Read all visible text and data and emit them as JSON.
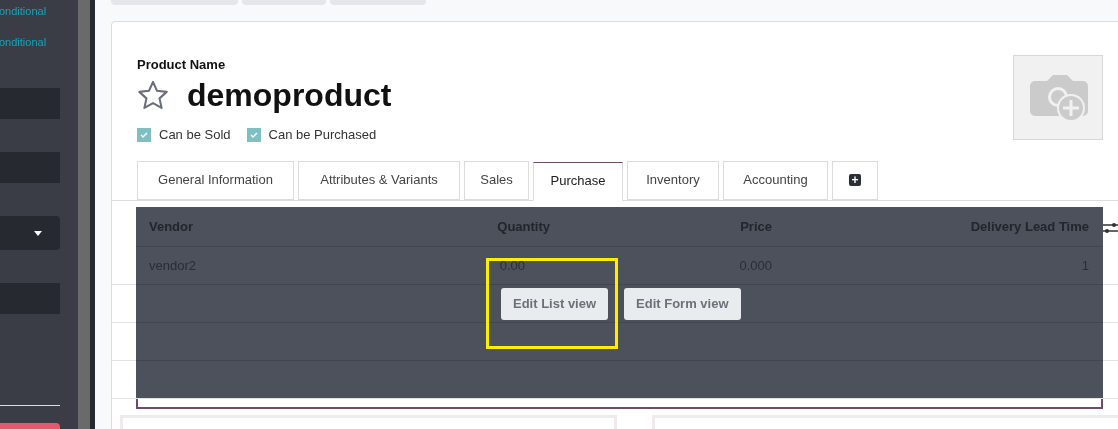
{
  "sidebar": {
    "links": [
      "onditional",
      "onditional"
    ],
    "fields": [
      {
        "kind": "input"
      },
      {
        "kind": "input"
      },
      {
        "kind": "select"
      },
      {
        "kind": "input"
      }
    ]
  },
  "product": {
    "label": "Product Name",
    "name": "demoproduct",
    "favorite": false,
    "options": [
      {
        "label": "Can be Sold",
        "checked": true
      },
      {
        "label": "Can be Purchased",
        "checked": true
      }
    ]
  },
  "tabs": [
    {
      "label": "General Information",
      "selected": false
    },
    {
      "label": "Attributes & Variants",
      "selected": false
    },
    {
      "label": "Sales",
      "selected": false
    },
    {
      "label": "Purchase",
      "selected": true
    },
    {
      "label": "Inventory",
      "selected": false
    },
    {
      "label": "Accounting",
      "selected": false
    },
    {
      "label": "+",
      "kind": "add",
      "selected": false
    }
  ],
  "table": {
    "columns": [
      {
        "label": "Vendor"
      },
      {
        "label": "Quantity"
      },
      {
        "label": "Price"
      },
      {
        "label": "Delivery Lead Time"
      }
    ],
    "rows": [
      [
        "vendor2",
        "0.00",
        "0.000",
        "1"
      ]
    ]
  },
  "overlay_buttons": [
    "Edit List view",
    "Edit Form view"
  ]
}
